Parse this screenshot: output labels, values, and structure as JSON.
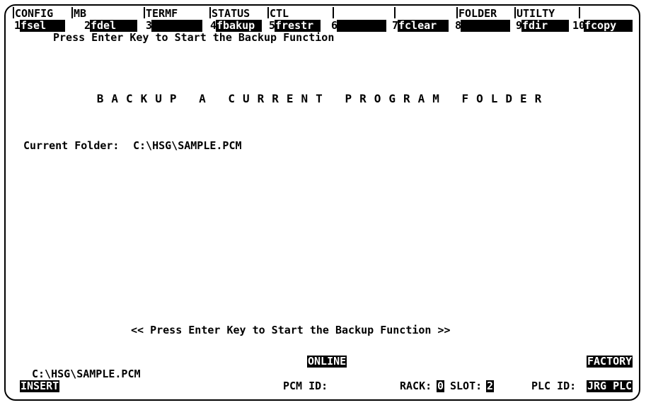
{
  "menu": [
    {
      "label": "CONFIG"
    },
    {
      "label": "MB"
    },
    {
      "label": "TERMF"
    },
    {
      "label": "STATUS"
    },
    {
      "label": "CTL"
    },
    {
      "label": ""
    },
    {
      "label": ""
    },
    {
      "label": "FOLDER"
    },
    {
      "label": "UTILTY"
    }
  ],
  "fkeys": [
    {
      "num": "1",
      "label": "fsel"
    },
    {
      "num": "2",
      "label": "fdel"
    },
    {
      "num": "3",
      "label": ""
    },
    {
      "num": "4",
      "label": "fbakup"
    },
    {
      "num": "5",
      "label": "frestr"
    },
    {
      "num": "6",
      "label": ""
    },
    {
      "num": "7",
      "label": "fclear"
    },
    {
      "num": "8",
      "label": ""
    },
    {
      "num": "9",
      "label": "fdir"
    },
    {
      "num": "10",
      "label": "fcopy"
    }
  ],
  "prompt_top": "Press Enter Key to Start the Backup Function",
  "screen_title": "BACKUP A CURRENT PROGRAM FOLDER",
  "current_folder_label": "Current Folder:",
  "current_folder_value": "C:\\HSG\\SAMPLE.PCM",
  "prompt_bottom": "<< Press Enter Key to Start the Backup Function >>",
  "status": {
    "online": "ONLINE",
    "factory": "FACTORY",
    "path": "C:\\HSG\\SAMPLE.PCM",
    "insert": "INSERT",
    "pcm_id_label": "PCM ID:",
    "rack_label": "RACK:",
    "rack_value": "0",
    "slot_label": "SLOT:",
    "slot_value": "2",
    "plc_id_label": "PLC ID:",
    "plc_id_value": "JRG PLC"
  }
}
